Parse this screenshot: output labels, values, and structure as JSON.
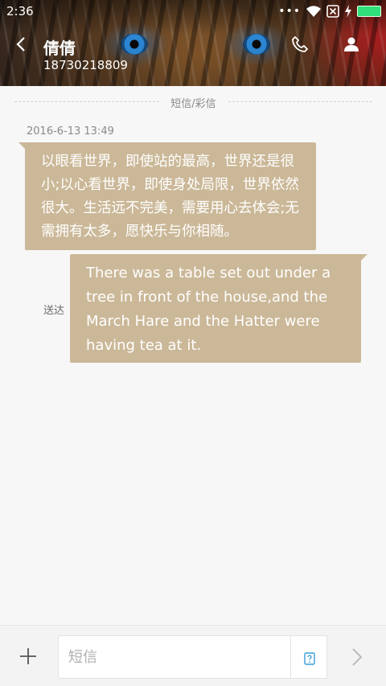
{
  "status_bar": {
    "time": "2:36",
    "more": "•••",
    "icons": [
      "wifi-icon",
      "sim-off-icon",
      "charging-bolt-icon",
      "battery-icon"
    ],
    "battery_color": "#2fe07a"
  },
  "header": {
    "contact_name": "倩倩",
    "phone_number": "18730218809",
    "icons": [
      "back-arrow-icon",
      "phone-icon",
      "contact-icon"
    ]
  },
  "thread": {
    "divider_label": "短信/彩信",
    "timestamp": "2016-6-13 13:49",
    "messages": [
      {
        "direction": "incoming",
        "text": "以眼看世界，即使站的最高，世界还是很小;以心看世界，即使身处局限，世界依然很大。生活远不完美，需要用心去体会;无需拥有太多，愿快乐与你相随。"
      },
      {
        "direction": "outgoing",
        "text": "There was a table set out under a tree in front of the house,and the March Hare and the Hatter were having tea at it.",
        "status": "送达"
      }
    ],
    "bubble_color": "#cbb898"
  },
  "composer": {
    "placeholder": "短信",
    "value": "",
    "icons": [
      "add-icon",
      "template-icon",
      "send-arrow-icon"
    ]
  }
}
